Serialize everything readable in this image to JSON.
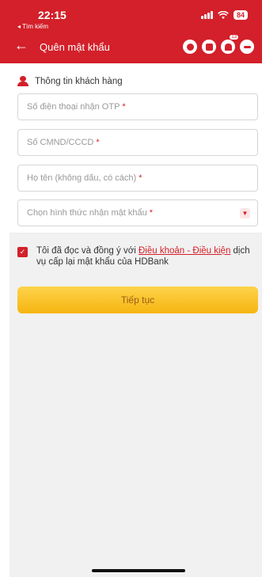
{
  "status_bar": {
    "time": "22:15",
    "back_app": "◂ Tìm kiếm",
    "battery": "84"
  },
  "nav": {
    "back_arrow": "←",
    "title": "Quên mật khẩu",
    "notification_count": "13"
  },
  "section": {
    "title": "Thông tin khách hàng"
  },
  "form": {
    "phone_placeholder": "Số điện thoại nhận OTP",
    "id_placeholder": "Số CMND/CCCD",
    "name_placeholder": "Họ tên (không dấu, có cách)",
    "method_placeholder": "Chọn hình thức nhận mật khẩu",
    "required_mark": "*"
  },
  "terms": {
    "prefix": "Tôi đã đọc và đồng ý với ",
    "link": "Điều khoản - Điều kiện",
    "suffix": " dịch vụ cấp lại mật khẩu của HDBank",
    "checked_mark": "✓"
  },
  "submit": {
    "label": "Tiếp tục"
  },
  "colors": {
    "brand_red": "#d3202a",
    "button_yellow": "#f6b510"
  },
  "icons": [
    "back-arrow-icon",
    "headset-icon",
    "qr-icon",
    "bell-icon",
    "menu-icon",
    "person-icon",
    "chevron-down-icon",
    "checkbox-icon"
  ]
}
